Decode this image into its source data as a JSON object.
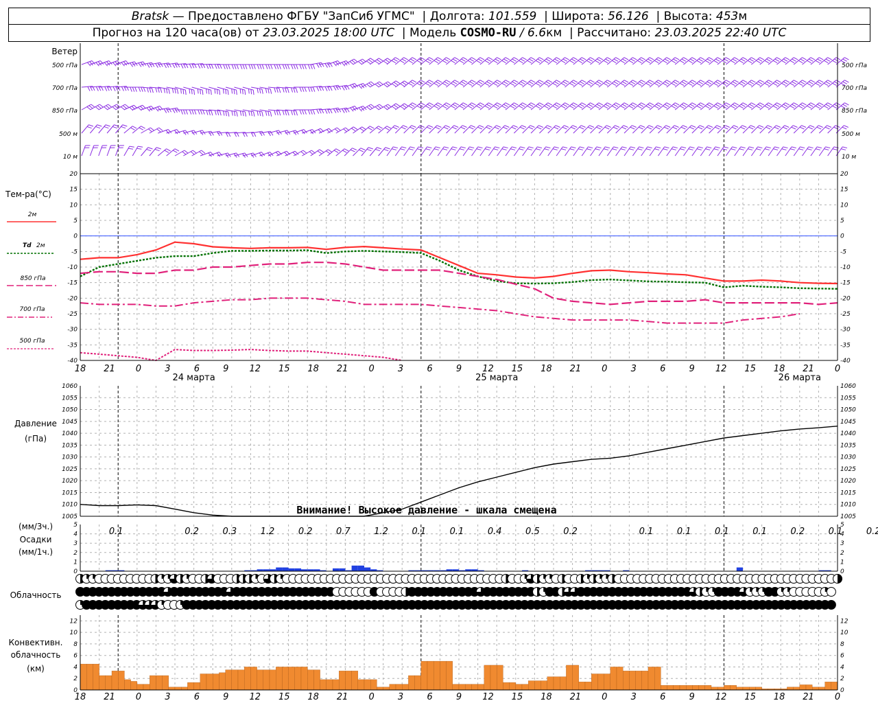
{
  "header": {
    "location": "Bratsk",
    "provider": "— Предоставлено ФГБУ \"ЗапСиб УГМС\"",
    "lon_label": "Долгота:",
    "lon_value": "101.559",
    "lat_label": "Широта:",
    "lat_value": "56.126",
    "alt_label": "Высота:",
    "alt_value": "453",
    "alt_unit": "м",
    "forecast_prefix": "Прогноз на 120 часа(ов) от",
    "forecast_start": "23.03.2025 18:00 UTC",
    "model_label": "Модель",
    "model_name": "COSMO-RU",
    "model_res": "/ 6.6",
    "model_res_unit": "км",
    "computed_label": "Рассчитано:",
    "computed_value": "23.03.2025 22:40 UTC"
  },
  "labels": {
    "wind": "Ветер",
    "wind_levels": [
      "500 гПа",
      "700 гПа",
      "850 гПа",
      "500 м",
      "10  м"
    ],
    "temp": "Тем-ра(°С)",
    "t2m": "2м",
    "td_a": "Td",
    "td_b": "2м",
    "t850": "850 гПа",
    "t700": "700 гПа",
    "t500": "500 гПа",
    "pressure_a": "Давление",
    "pressure_b": "(гПа)",
    "pressure_warning": "Внимание! Высокое давление - шкала смещена",
    "precip_a": "(мм/3ч.)",
    "precip_b": "Осадки",
    "precip_c": "(мм/1ч.)",
    "cloud": "Облачность",
    "conv_a": "Конвективн.",
    "conv_b": "облачность",
    "conv_c": "(км)"
  },
  "x_axis": {
    "hour_labels": [
      "18",
      "21",
      "0",
      "3",
      "6",
      "9",
      "12",
      "15",
      "18",
      "21",
      "0",
      "3",
      "6",
      "9",
      "12",
      "15",
      "18",
      "21",
      "0",
      "3",
      "6",
      "9",
      "12",
      "15",
      "18",
      "21",
      "0"
    ],
    "date_labels": [
      "24 марта",
      "25 марта",
      "26 марта"
    ]
  },
  "colors": {
    "t2m": "#ff3030",
    "td": "#007000",
    "t850": "#e0207a",
    "t700": "#e0207a",
    "t500": "#e0207a",
    "wind": "#8a2be2",
    "pressure": "#000000",
    "precip": "#2040e0",
    "conv": "#f08a30",
    "zero": "#3050ff"
  },
  "chart_data": [
    {
      "type": "line",
      "name": "temperature",
      "x_hours": [
        0,
        3,
        6,
        9,
        12,
        15,
        18,
        21,
        24,
        27,
        30,
        33,
        36,
        39,
        42,
        45,
        48,
        51,
        54,
        57,
        60,
        63,
        66,
        69,
        72,
        75,
        78,
        81,
        84,
        87,
        90,
        93,
        96,
        99,
        102,
        105,
        108,
        111,
        114,
        117,
        120
      ],
      "ylim": [
        -40,
        20
      ],
      "yticks": [
        -40,
        -35,
        -30,
        -25,
        -20,
        -15,
        -10,
        -5,
        0,
        5,
        10,
        15,
        20
      ],
      "series": [
        {
          "name": "2м",
          "values": [
            -7.5,
            -7,
            -7,
            -6,
            -4.5,
            -2,
            -2.5,
            -3.5,
            -3.8,
            -4,
            -3.8,
            -3.8,
            -3.7,
            -4.3,
            -3.7,
            -3.4,
            -3.8,
            -4.2,
            -4.5,
            -7,
            -9.5,
            -12,
            -12.5,
            -13.2,
            -13.5,
            -13,
            -12,
            -11.2,
            -11,
            -11.5,
            -11.8,
            -12.2,
            -12.5,
            -13.5,
            -14.5,
            -14.5,
            -14.2,
            -14.5,
            -15,
            -15.2,
            -15.3
          ]
        },
        {
          "name": "Td 2м",
          "values": [
            -13,
            -10,
            -9,
            -8,
            -7,
            -6.5,
            -6.5,
            -5.5,
            -4.8,
            -4.8,
            -4.7,
            -4.7,
            -4.6,
            -5.5,
            -5,
            -4.8,
            -5,
            -5.2,
            -5.5,
            -8,
            -11,
            -13,
            -14.5,
            -15.2,
            -15.3,
            -15.2,
            -14.8,
            -14.2,
            -14,
            -14.3,
            -14.6,
            -14.7,
            -14.9,
            -15,
            -16.5,
            -16,
            -16.3,
            -16.5,
            -16.8,
            -16.9,
            -17
          ]
        },
        {
          "name": "850 гПа",
          "values": [
            -12,
            -11.5,
            -11.5,
            -12,
            -12,
            -11,
            -11,
            -10,
            -10,
            -9.5,
            -9,
            -9,
            -8.5,
            -8.5,
            -9,
            -10,
            -11,
            -11,
            -11,
            -11,
            -12,
            -13,
            -14,
            -15.5,
            -17,
            -20,
            -21,
            -21.5,
            -22,
            -21.5,
            -21,
            -21,
            -21,
            -20.5,
            -21.5,
            -21.5,
            -21.5,
            -21.5,
            -21.5,
            -22,
            -21.5
          ]
        },
        {
          "name": "700 гПа",
          "values": [
            -21.5,
            -22,
            -22,
            -22,
            -22.5,
            -22.5,
            -21.5,
            -21,
            -20.5,
            -20.5,
            -20,
            -20,
            -20,
            -20.5,
            -21,
            -22,
            -22,
            -22,
            -22,
            -22.5,
            -23,
            -23.5,
            -24,
            -25,
            -26,
            -26.5,
            -27,
            -27,
            -27,
            -27,
            -27.5,
            -28,
            -28,
            -28,
            -28,
            -27,
            -26.5,
            -26,
            -25
          ]
        },
        {
          "name": "500 гПа",
          "values": [
            -37.5,
            -38,
            -38.5,
            -39,
            -40,
            -36.5,
            -36.8,
            -36.8,
            -36.7,
            -36.5,
            -36.8,
            -37,
            -37,
            -37.5,
            -38,
            -38.5,
            -39,
            -40
          ]
        }
      ]
    },
    {
      "type": "line",
      "name": "pressure",
      "ylim": [
        1005,
        1060
      ],
      "yticks": [
        1005,
        1010,
        1015,
        1020,
        1025,
        1030,
        1035,
        1040,
        1045,
        1050,
        1055,
        1060
      ],
      "x_hours": [
        0,
        3,
        6,
        9,
        12,
        15,
        18,
        21,
        24,
        27,
        30,
        33,
        36,
        39,
        42,
        45,
        48,
        51,
        54,
        57,
        60,
        63,
        66,
        69,
        72,
        75,
        78,
        81,
        84,
        87,
        90,
        93,
        96,
        99,
        102,
        105,
        108,
        111,
        114,
        117,
        120
      ],
      "values": [
        1010,
        1009.5,
        1009.5,
        1009.8,
        1009.5,
        1008,
        1006.5,
        1005.5,
        1004.8,
        1004.2,
        1003.8,
        1003.5,
        1003.3,
        1003.5,
        1004,
        1005,
        1006.5,
        1008,
        1011,
        1014,
        1017,
        1019.5,
        1021.5,
        1023.5,
        1025.5,
        1027,
        1028,
        1029,
        1029.5,
        1030.5,
        1032,
        1033.5,
        1035,
        1036.5,
        1038,
        1039,
        1040,
        1041,
        1041.8,
        1042.3,
        1043
      ]
    },
    {
      "type": "bar",
      "name": "precipitation",
      "ylim": [
        0,
        5
      ],
      "yticks": [
        0,
        1,
        2,
        3,
        4,
        5
      ],
      "totals_3h": [
        "0.1",
        "",
        "0.2",
        "0.3",
        "1.2",
        "0.2",
        "0.7",
        "1.2",
        "0.1",
        "0.1",
        "0.4",
        "0.5",
        "0.2",
        "",
        "0.1",
        "0.1",
        "0.1",
        "0.1",
        "0.2",
        "0.1",
        "0.2",
        "0.1",
        "0.1",
        "0.1"
      ],
      "hourly": [
        0,
        0,
        0,
        0,
        0.1,
        0.1,
        0.1,
        0,
        0,
        0,
        0,
        0,
        0,
        0,
        0,
        0,
        0,
        0,
        0,
        0,
        0,
        0,
        0,
        0,
        0,
        0,
        0.1,
        0.1,
        0.2,
        0.2,
        0.2,
        0.4,
        0.4,
        0.3,
        0.3,
        0.2,
        0.2,
        0.2,
        0.1,
        0,
        0.3,
        0.3,
        0.1,
        0.6,
        0.6,
        0.4,
        0.2,
        0.1,
        0,
        0,
        0,
        0,
        0.1,
        0.1,
        0.1,
        0.1,
        0.1,
        0.1,
        0.2,
        0.2,
        0.1,
        0.2,
        0.2,
        0.1,
        0,
        0,
        0,
        0,
        0,
        0,
        0.1,
        0,
        0,
        0,
        0,
        0,
        0,
        0,
        0,
        0,
        0.1,
        0.1,
        0.1,
        0.1,
        0,
        0,
        0.1,
        0,
        0,
        0,
        0,
        0,
        0,
        0,
        0,
        0,
        0,
        0,
        0,
        0,
        0,
        0,
        0,
        0,
        0.4,
        0,
        0,
        0,
        0,
        0,
        0,
        0,
        0,
        0,
        0,
        0,
        0,
        0.1,
        0.1,
        0,
        0
      ]
    },
    {
      "type": "bar",
      "name": "convective",
      "ylim": [
        0,
        13
      ],
      "yticks": [
        0,
        2,
        4,
        6,
        8,
        10,
        12
      ],
      "hourly_top": [
        4.5,
        4.5,
        4.5,
        2.5,
        2.5,
        3.3,
        3.3,
        1.8,
        1.5,
        1,
        1,
        2.5,
        2.5,
        2.5,
        0.5,
        0.5,
        0.5,
        1.3,
        1.3,
        2.8,
        2.8,
        2.8,
        3,
        3.5,
        3.5,
        3.5,
        4,
        4,
        3.5,
        3.5,
        3.5,
        4,
        4,
        4,
        4,
        4,
        3.5,
        3.5,
        1.8,
        1.8,
        1.8,
        3.3,
        3.3,
        3.3,
        1.8,
        1.8,
        1.8,
        0.5,
        0.5,
        1,
        1,
        1,
        2.5,
        2.5,
        5,
        5,
        5,
        5,
        5,
        1,
        1,
        1,
        1,
        1,
        4.3,
        4.3,
        4.3,
        1.3,
        1.3,
        1,
        1,
        1.6,
        1.6,
        1.6,
        2.3,
        2.3,
        2.3,
        4.3,
        4.3,
        1.4,
        1.4,
        2.8,
        2.8,
        2.8,
        4,
        4,
        3.3,
        3.3,
        3.3,
        3.3,
        4,
        4,
        0.8,
        0.8,
        0.8,
        0.8,
        0.8,
        0.8,
        0.8,
        0.8,
        0.5,
        0.5,
        0.8,
        0.8,
        0.5,
        0.5,
        0.5,
        0.5,
        0.2,
        0.2,
        0.2,
        0.2,
        0.5,
        0.5,
        0.9,
        0.9,
        0.5,
        0.5,
        1.4,
        1.4
      ]
    },
    {
      "type": "table",
      "name": "cloudiness",
      "rows": 3,
      "cover_levels": "0..4 quarters",
      "upper": [
        2,
        1,
        1,
        0,
        0,
        0,
        0,
        0,
        0,
        0,
        0,
        0,
        2,
        1,
        1,
        3,
        2,
        1,
        0,
        0,
        2,
        3,
        0,
        0,
        0,
        2,
        2,
        2,
        1,
        0,
        3,
        2,
        1,
        0,
        0,
        0,
        0,
        0,
        0,
        0,
        0,
        0,
        0,
        0,
        0,
        0,
        0,
        0,
        0,
        0,
        0,
        0,
        0,
        0,
        0,
        0,
        0,
        0,
        0,
        0,
        0,
        0,
        0,
        0,
        0,
        0,
        0,
        0,
        2,
        0,
        0,
        1,
        3,
        2,
        1,
        1,
        0,
        2,
        0,
        0,
        2,
        1,
        2,
        1,
        1,
        2,
        0,
        0,
        0,
        0,
        0,
        0,
        0,
        0,
        0,
        0,
        0,
        0,
        0,
        0,
        0,
        0,
        0,
        0,
        0,
        0,
        0,
        0,
        0,
        0,
        0,
        0,
        0,
        0,
        0,
        0,
        0,
        0,
        0,
        0,
        0,
        2
      ],
      "middle": [
        4,
        4,
        4,
        4,
        4,
        4,
        4,
        4,
        4,
        4,
        4,
        4,
        4,
        4,
        3,
        4,
        4,
        4,
        4,
        4,
        4,
        4,
        4,
        4,
        3,
        4,
        4,
        4,
        4,
        4,
        4,
        4,
        4,
        4,
        4,
        4,
        4,
        4,
        4,
        4,
        4,
        0,
        0,
        0,
        0,
        0,
        0,
        4,
        0,
        0,
        0,
        0,
        2,
        4,
        4,
        4,
        4,
        4,
        4,
        4,
        4,
        4,
        4,
        4,
        3,
        4,
        4,
        4,
        4,
        4,
        4,
        4,
        4,
        2,
        1,
        4,
        4,
        2,
        3,
        3,
        4,
        4,
        4,
        4,
        4,
        4,
        4,
        4,
        4,
        4,
        4,
        4,
        4,
        4,
        4,
        4,
        4,
        4,
        3,
        2,
        1,
        1,
        4,
        4,
        4,
        4,
        3,
        1,
        1,
        1,
        4,
        4,
        1,
        1,
        0,
        0,
        0,
        0,
        0,
        1,
        0
      ],
      "lower": [
        1,
        4,
        4,
        4,
        4,
        4,
        4,
        4,
        4,
        4,
        3,
        3,
        3,
        1,
        0,
        0,
        1,
        4,
        4,
        4,
        4,
        4,
        4,
        4,
        4,
        4,
        4,
        4,
        4,
        4,
        4,
        4,
        4,
        4,
        4,
        4,
        4,
        4,
        4,
        4,
        4,
        4,
        4,
        4,
        4,
        4,
        4,
        4,
        4,
        4,
        4,
        4,
        4,
        4,
        4,
        4,
        4,
        4,
        4,
        4,
        4,
        4,
        4,
        4,
        4,
        4,
        4,
        4,
        4,
        4,
        4,
        4,
        4,
        4,
        4,
        4,
        4,
        4,
        4,
        4,
        4,
        4,
        4,
        4,
        4,
        4,
        4,
        4,
        4,
        4,
        4,
        4,
        4,
        4,
        4,
        4,
        4,
        4,
        4,
        4,
        4,
        4,
        4,
        4,
        4,
        4,
        4,
        4,
        4,
        4,
        4,
        4,
        4,
        4,
        4,
        4,
        4,
        4,
        4,
        4,
        4
      ]
    }
  ]
}
